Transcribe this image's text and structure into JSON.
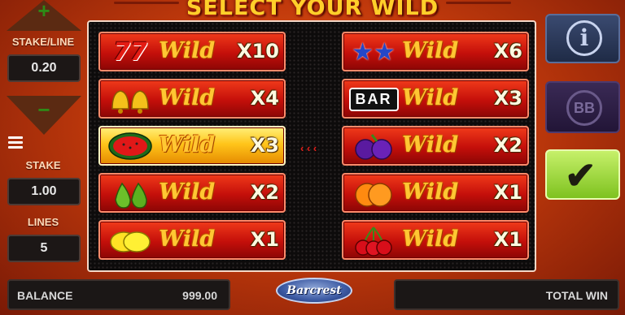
{
  "title": "SELECT YOUR WILD",
  "left_panel": {
    "stake_line_label": "STAKE/LINE",
    "stake_line_value": "0.20",
    "stake_label": "STAKE",
    "stake_value": "1.00",
    "lines_label": "LINES",
    "lines_value": "5",
    "increase_glyph": "+",
    "decrease_glyph": "−"
  },
  "wild_options": [
    {
      "symbol": "sevens-icon",
      "symbol_text": "77",
      "label": "Wild",
      "multiplier": "X10",
      "selected": false
    },
    {
      "symbol": "star-icon",
      "symbol_text": "★★",
      "label": "Wild",
      "multiplier": "X6",
      "selected": false
    },
    {
      "symbol": "bells-icon",
      "symbol_text": "",
      "label": "Wild",
      "multiplier": "X4",
      "selected": false
    },
    {
      "symbol": "bar-icon",
      "symbol_text": "BAR",
      "label": "Wild",
      "multiplier": "X3",
      "selected": false
    },
    {
      "symbol": "watermelon-icon",
      "symbol_text": "",
      "label": "Wild",
      "multiplier": "X3",
      "selected": true
    },
    {
      "symbol": "plums-icon",
      "symbol_text": "",
      "label": "Wild",
      "multiplier": "X2",
      "selected": false
    },
    {
      "symbol": "pears-icon",
      "symbol_text": "",
      "label": "Wild",
      "multiplier": "X2",
      "selected": false
    },
    {
      "symbol": "orange-icon",
      "symbol_text": "",
      "label": "Wild",
      "multiplier": "X1",
      "selected": false
    },
    {
      "symbol": "lemon-icon",
      "symbol_text": "",
      "label": "Wild",
      "multiplier": "X1",
      "selected": false
    },
    {
      "symbol": "cherries-icon",
      "symbol_text": "",
      "label": "Wild",
      "multiplier": "X1",
      "selected": false
    }
  ],
  "selection_indicator": "‹ ‹ ‹",
  "right_panel": {
    "info_glyph": "i",
    "bb_glyph": "BB",
    "confirm_glyph": "✔"
  },
  "bottom_bar": {
    "balance_label": "BALANCE",
    "balance_value": "999.00",
    "total_win_label": "TOTAL WIN",
    "logo_text": "Barcrest"
  },
  "colors": {
    "wild_gold": "#ffc733",
    "button_red": "#c40f0a",
    "selected_gold": "#ffc51a",
    "confirm_green": "#7ec21f"
  }
}
